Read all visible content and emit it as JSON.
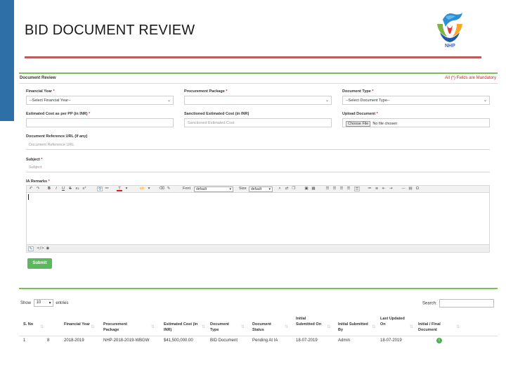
{
  "slide": {
    "title": "BID DOCUMENT REVIEW",
    "logo_text": "NHP"
  },
  "form": {
    "title": "Document Review",
    "mandatory_note": "All (*) Fields are Mandatory",
    "financial_year": {
      "label": "Financial Year",
      "value": "--Select Financial Year--"
    },
    "procurement_package": {
      "label": "Procurement Package",
      "value": ""
    },
    "document_type": {
      "label": "Document Type",
      "value": "--Select Document Type--"
    },
    "estimated_cost": {
      "label": "Estimated Cost as per PP (in INR)",
      "value": ""
    },
    "sanctioned_cost": {
      "label": "Sanctioned Estimated Cost (in INR)",
      "placeholder": "Sanctioned Estimated Cost"
    },
    "upload_document": {
      "label": "Upload Document",
      "button": "Choose File",
      "status": "No file chosen"
    },
    "reference_url": {
      "label": "Document Reference URL (If any)",
      "placeholder": "Document Reference URL"
    },
    "subject": {
      "label": "Subject",
      "placeholder": "Subject"
    },
    "remarks": {
      "label": "IA Remarks"
    },
    "toolbar": {
      "font_label": "Font",
      "font_value": "default",
      "size_label": "Size",
      "size_value": "default"
    },
    "submit": "Submit"
  },
  "list": {
    "show_label": "Show",
    "entries_value": "10",
    "entries_label": "entries",
    "search_label": "Search:",
    "columns": [
      "S. No",
      "Financial Year",
      "Procurement Package",
      "Estimated Cost (in INR)",
      "Document Type",
      "Document Status",
      "Initial Submitted On",
      "Initial Submitted By",
      "Last Updated On",
      "Initial / Final Document"
    ],
    "row": {
      "sno": "1",
      "id": "8",
      "year": "2018-2019",
      "package": "NHP-2018-2019-WBGW",
      "cost": "$41,500,000.00",
      "doc_type": "BID Document",
      "status": "Pending At IA",
      "submitted_on": "18-07-2019",
      "submitted_by": "Admin",
      "updated_on": "18-07-2019",
      "final_flag": "I"
    }
  }
}
